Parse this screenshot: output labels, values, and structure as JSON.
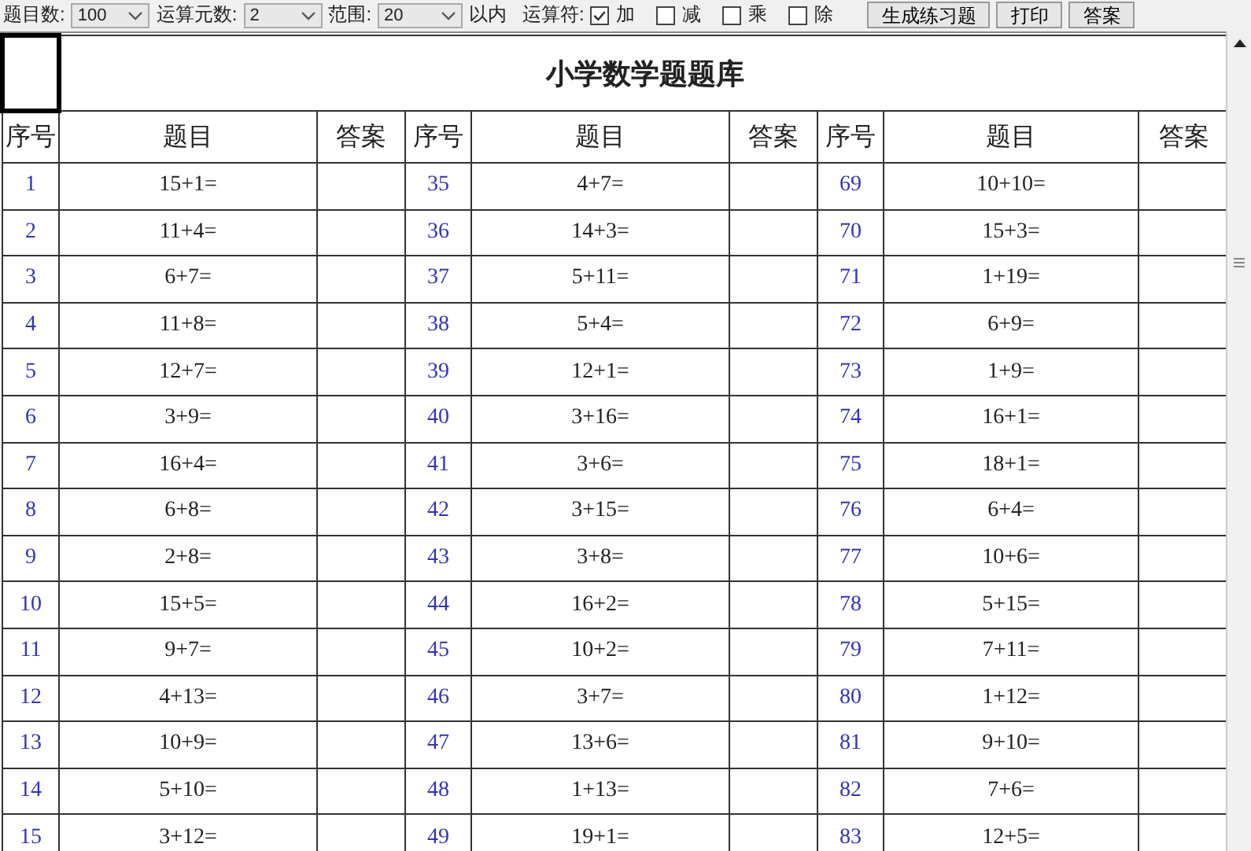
{
  "toolbar": {
    "count_label": "题目数:",
    "count_value": "100",
    "operands_label": "运算元数:",
    "operands_value": "2",
    "range_label": "范围:",
    "range_value": "20",
    "range_suffix": "以内",
    "operators_label": "运算符:",
    "operators": [
      {
        "label": "加",
        "checked": true
      },
      {
        "label": "减",
        "checked": false
      },
      {
        "label": "乘",
        "checked": false
      },
      {
        "label": "除",
        "checked": false
      }
    ],
    "buttons": [
      "生成练习题",
      "打印",
      "答案"
    ]
  },
  "sheet": {
    "title": "小学数学题题库",
    "header": [
      "序号",
      "题目",
      "答案",
      "序号",
      "题目",
      "答案",
      "序号",
      "题目",
      "答案"
    ],
    "rows": [
      [
        {
          "no": "1",
          "question": "15+1="
        },
        {
          "no": "35",
          "question": "4+7="
        },
        {
          "no": "69",
          "question": "10+10="
        }
      ],
      [
        {
          "no": "2",
          "question": "11+4="
        },
        {
          "no": "36",
          "question": "14+3="
        },
        {
          "no": "70",
          "question": "15+3="
        }
      ],
      [
        {
          "no": "3",
          "question": "6+7="
        },
        {
          "no": "37",
          "question": "5+11="
        },
        {
          "no": "71",
          "question": "1+19="
        }
      ],
      [
        {
          "no": "4",
          "question": "11+8="
        },
        {
          "no": "38",
          "question": "5+4="
        },
        {
          "no": "72",
          "question": "6+9="
        }
      ],
      [
        {
          "no": "5",
          "question": "12+7="
        },
        {
          "no": "39",
          "question": "12+1="
        },
        {
          "no": "73",
          "question": "1+9="
        }
      ],
      [
        {
          "no": "6",
          "question": "3+9="
        },
        {
          "no": "40",
          "question": "3+16="
        },
        {
          "no": "74",
          "question": "16+1="
        }
      ],
      [
        {
          "no": "7",
          "question": "16+4="
        },
        {
          "no": "41",
          "question": "3+6="
        },
        {
          "no": "75",
          "question": "18+1="
        }
      ],
      [
        {
          "no": "8",
          "question": "6+8="
        },
        {
          "no": "42",
          "question": "3+15="
        },
        {
          "no": "76",
          "question": "6+4="
        }
      ],
      [
        {
          "no": "9",
          "question": "2+8="
        },
        {
          "no": "43",
          "question": "3+8="
        },
        {
          "no": "77",
          "question": "10+6="
        }
      ],
      [
        {
          "no": "10",
          "question": "15+5="
        },
        {
          "no": "44",
          "question": "16+2="
        },
        {
          "no": "78",
          "question": "5+15="
        }
      ],
      [
        {
          "no": "11",
          "question": "9+7="
        },
        {
          "no": "45",
          "question": "10+2="
        },
        {
          "no": "79",
          "question": "7+11="
        }
      ],
      [
        {
          "no": "12",
          "question": "4+13="
        },
        {
          "no": "46",
          "question": "3+7="
        },
        {
          "no": "80",
          "question": "1+12="
        }
      ],
      [
        {
          "no": "13",
          "question": "10+9="
        },
        {
          "no": "47",
          "question": "13+6="
        },
        {
          "no": "81",
          "question": "9+10="
        }
      ],
      [
        {
          "no": "14",
          "question": "5+10="
        },
        {
          "no": "48",
          "question": "1+13="
        },
        {
          "no": "82",
          "question": "7+6="
        }
      ],
      [
        {
          "no": "15",
          "question": "3+12="
        },
        {
          "no": "49",
          "question": "19+1="
        },
        {
          "no": "83",
          "question": "12+5="
        }
      ]
    ]
  }
}
